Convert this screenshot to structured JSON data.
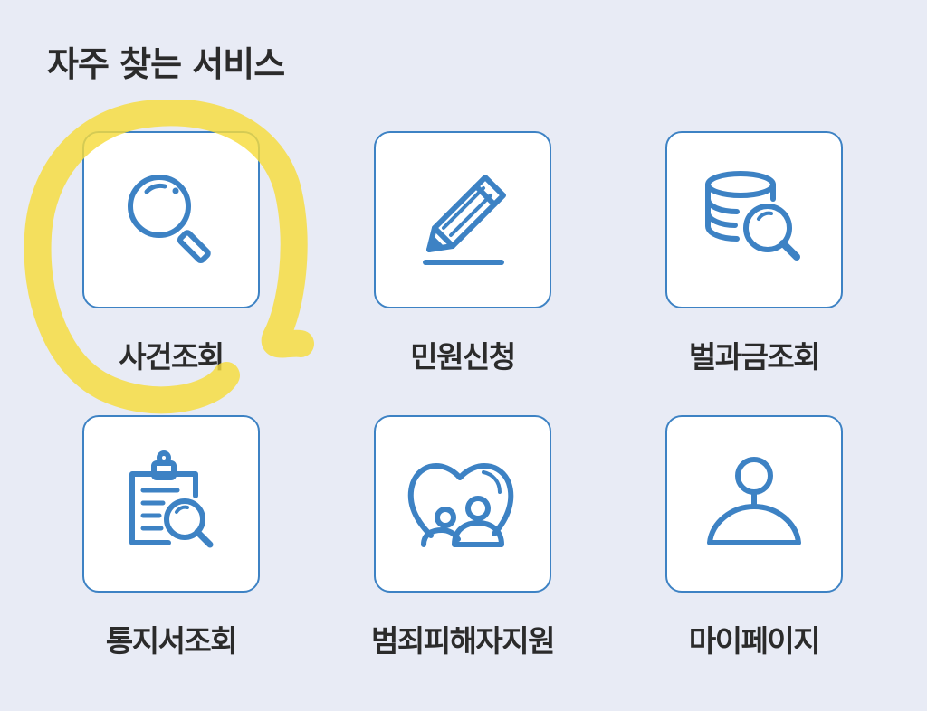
{
  "section": {
    "title": "자주 찾는 서비스"
  },
  "services": [
    {
      "label": "사건조회",
      "icon": "magnifier-icon"
    },
    {
      "label": "민원신청",
      "icon": "pencil-icon"
    },
    {
      "label": "벌과금조회",
      "icon": "coins-search-icon"
    },
    {
      "label": "통지서조회",
      "icon": "clipboard-search-icon"
    },
    {
      "label": "범죄피해자지원",
      "icon": "heart-family-icon"
    },
    {
      "label": "마이페이지",
      "icon": "user-icon"
    }
  ],
  "colors": {
    "background": "#e8ebf5",
    "icon": "#3d82c4",
    "tile_border": "#3d82c4",
    "text": "#2b2b2b",
    "highlight": "#f6dc3c"
  }
}
